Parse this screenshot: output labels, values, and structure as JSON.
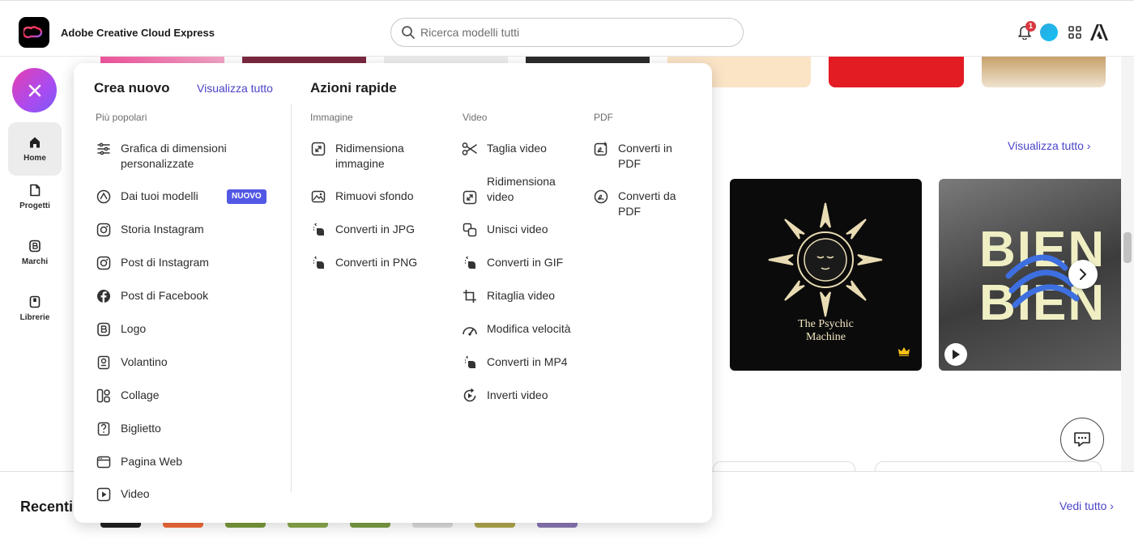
{
  "app": {
    "name": "Adobe Creative Cloud Express"
  },
  "search": {
    "placeholder": "Ricerca modelli tutti"
  },
  "notifications": {
    "count": "1"
  },
  "rail": {
    "items": [
      {
        "label": "Home",
        "icon": "home-icon"
      },
      {
        "label": "Progetti",
        "icon": "document-icon"
      },
      {
        "label": "Marchi",
        "icon": "brand-icon"
      },
      {
        "label": "Librerie",
        "icon": "library-icon"
      }
    ]
  },
  "menu": {
    "create_new": {
      "title": "Crea nuovo",
      "view_all": "Visualizza tutto",
      "section": "Più popolari",
      "badge_new": "NUOVO",
      "items": [
        {
          "label": "Grafica di dimensioni\npersonalizzate",
          "icon": "sliders-icon"
        },
        {
          "label": "Dai tuoi modelli",
          "icon": "template-icon"
        },
        {
          "label": "Storia Instagram",
          "icon": "instagram-icon"
        },
        {
          "label": "Post di Instagram",
          "icon": "instagram-icon"
        },
        {
          "label": "Post di Facebook",
          "icon": "facebook-icon"
        },
        {
          "label": "Logo",
          "icon": "logo-icon"
        },
        {
          "label": "Volantino",
          "icon": "flyer-icon"
        },
        {
          "label": "Collage",
          "icon": "collage-icon"
        },
        {
          "label": "Biglietto",
          "icon": "card-icon"
        },
        {
          "label": "Pagina Web",
          "icon": "webpage-icon"
        },
        {
          "label": "Video",
          "icon": "video-icon"
        }
      ]
    },
    "quick_actions": {
      "title": "Azioni rapide",
      "image": {
        "label": "Immagine",
        "items": [
          {
            "label": "Ridimensiona\nimmagine",
            "icon": "resize-icon"
          },
          {
            "label": "Rimuovi sfondo",
            "icon": "remove-background-icon"
          },
          {
            "label": "Converti in JPG",
            "icon": "convert-icon"
          },
          {
            "label": "Converti in PNG",
            "icon": "convert-icon"
          }
        ]
      },
      "video": {
        "label": "Video",
        "items": [
          {
            "label": "Taglia video",
            "icon": "scissors-icon"
          },
          {
            "label": "Ridimensiona\nvideo",
            "icon": "resize-icon"
          },
          {
            "label": "Unisci video",
            "icon": "merge-icon"
          },
          {
            "label": "Converti in GIF",
            "icon": "convert-icon"
          },
          {
            "label": "Ritaglia video",
            "icon": "crop-icon"
          },
          {
            "label": "Modifica velocità",
            "icon": "speed-icon"
          },
          {
            "label": "Converti in MP4",
            "icon": "convert-icon"
          },
          {
            "label": "Inverti video",
            "icon": "reverse-icon"
          }
        ]
      },
      "pdf": {
        "label": "PDF",
        "items": [
          {
            "label": "Converti in\nPDF",
            "icon": "pdf-convert-icon"
          },
          {
            "label": "Converti da\nPDF",
            "icon": "pdf-icon"
          }
        ]
      }
    }
  },
  "main": {
    "view_all": "Visualizza tutto",
    "cards": [
      {
        "title": "The Psychic\nMachine",
        "premium": true
      },
      {
        "title": "BIEN\nBIEN",
        "video": true
      }
    ],
    "recents": {
      "title": "Recenti",
      "see_all": "Vedi tutto"
    }
  },
  "colors": {
    "accent": "#4b44c9",
    "badge": "#5258e4",
    "fab_start": "#e63fb0",
    "fab_end": "#7a5bf5"
  }
}
